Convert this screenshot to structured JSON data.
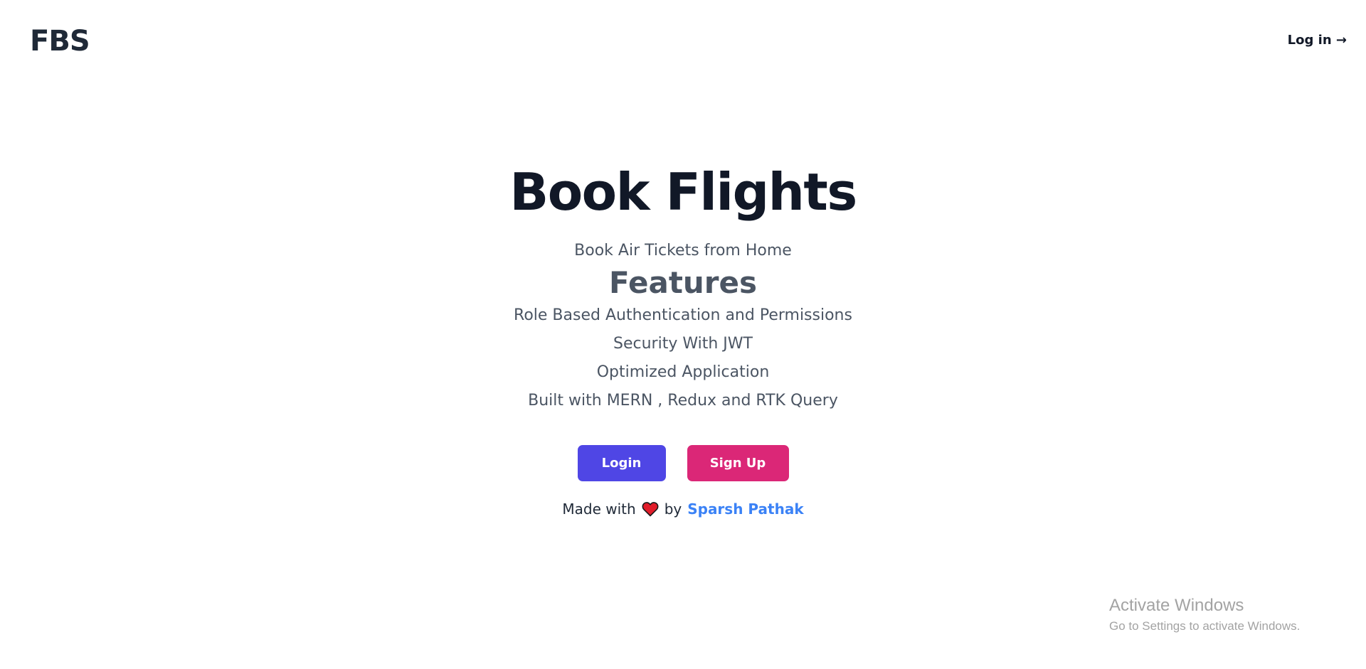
{
  "header": {
    "logo": "FBS",
    "login_link": "Log in →"
  },
  "hero": {
    "title": "Book Flights",
    "subtitle": "Book Air Tickets from Home",
    "features_heading": "Features",
    "features": [
      "Role Based Authentication and Permissions",
      "Security With JWT",
      "Optimized Application",
      "Built with MERN , Redux and RTK Query"
    ]
  },
  "actions": {
    "login_label": "Login",
    "signup_label": "Sign Up"
  },
  "credit": {
    "prefix": "Made with",
    "icon": "heart-icon",
    "by": "by",
    "author": "Sparsh Pathak"
  },
  "watermark": {
    "title": "Activate Windows",
    "subtitle": "Go to Settings to activate Windows."
  },
  "colors": {
    "login_button": "#4f46e5",
    "signup_button": "#db2777",
    "author_link": "#3b82f6",
    "heart": "#e11d2a"
  }
}
